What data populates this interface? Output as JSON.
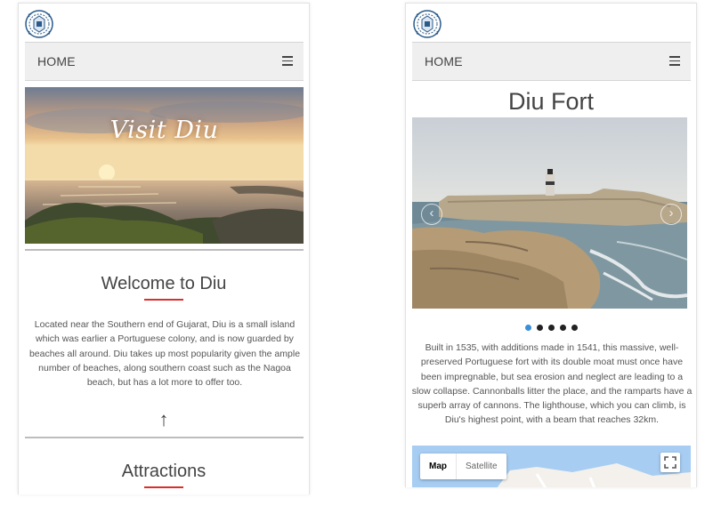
{
  "left_page": {
    "nav": {
      "home_label": "HOME",
      "menu_icon": "hamburger-icon"
    },
    "hero": {
      "title": "Visit Diu"
    },
    "welcome": {
      "heading": "Welcome to Diu",
      "body": "Located near the Southern end of Gujarat, Diu is a small island which was earlier a Portuguese colony, and is now guarded by beaches all around. Diu takes up most popularity given the ample number of beaches, along southern coast such as the Nagoa beach, but has a lot more to offer too."
    },
    "scroll_top_glyph": "↑",
    "attractions": {
      "heading": "Attractions"
    }
  },
  "right_page": {
    "nav": {
      "home_label": "HOME",
      "menu_icon": "hamburger-icon"
    },
    "heading": "Diu Fort",
    "carousel": {
      "slide_count": 5,
      "active_index": 0,
      "prev_icon": "chevron-left-icon",
      "next_icon": "chevron-right-icon"
    },
    "body": "Built in 1535, with additions made in 1541, this massive, well-preserved Portuguese fort with its double moat must once have been impregnable, but sea erosion and neglect are leading to a slow collapse. Cannonballs litter the place, and the ramparts have a superb array of cannons. The lighthouse, which you can climb, is Diu's highest point, with a beam that reaches 32km.",
    "map": {
      "map_label": "Map",
      "satellite_label": "Satellite",
      "fullscreen_icon": "fullscreen-icon"
    }
  },
  "colors": {
    "accent_red": "#d9302c",
    "nav_bg": "#efefef",
    "dot_active": "#3a8fd9",
    "map_water": "#a7cdf2"
  }
}
